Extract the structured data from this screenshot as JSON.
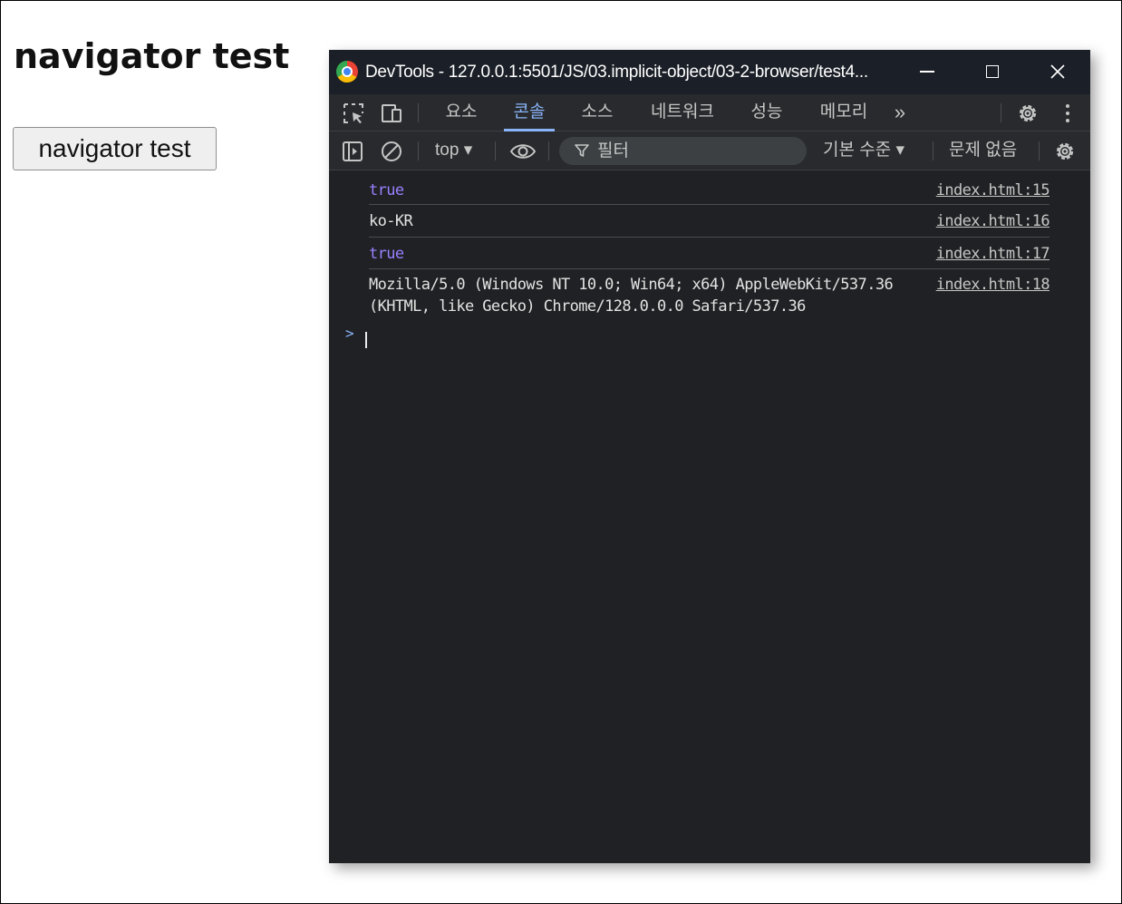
{
  "page": {
    "heading": "navigator test",
    "button_label": "navigator test"
  },
  "devtools": {
    "window_title": "DevTools - 127.0.0.1:5501/JS/03.implicit-object/03-2-browser/test4...",
    "tabs": [
      {
        "label": "요소",
        "active": false
      },
      {
        "label": "콘솔",
        "active": true
      },
      {
        "label": "소스",
        "active": false
      },
      {
        "label": "네트워크",
        "active": false
      },
      {
        "label": "성능",
        "active": false
      },
      {
        "label": "메모리",
        "active": false
      }
    ],
    "more_tabs": "»",
    "toolbar": {
      "context": "top ▾",
      "filter_placeholder": "필터",
      "levels": "기본 수준 ▾",
      "issues": "문제 없음"
    },
    "console": [
      {
        "message": "true",
        "type": "boolean",
        "source": "index.html:15"
      },
      {
        "message": "ko-KR",
        "type": "string",
        "source": "index.html:16"
      },
      {
        "message": "true",
        "type": "boolean",
        "source": "index.html:17"
      },
      {
        "message": "Mozilla/5.0 (Windows NT 10.0; Win64; x64) AppleWebKit/537.36\n(KHTML, like Gecko) Chrome/128.0.0.0 Safari/537.36",
        "type": "string",
        "source": "index.html:18"
      }
    ],
    "prompt_symbol": ">"
  },
  "colors": {
    "accent": "#8ab4f8",
    "boolean": "#9980ff",
    "background": "#202124"
  }
}
